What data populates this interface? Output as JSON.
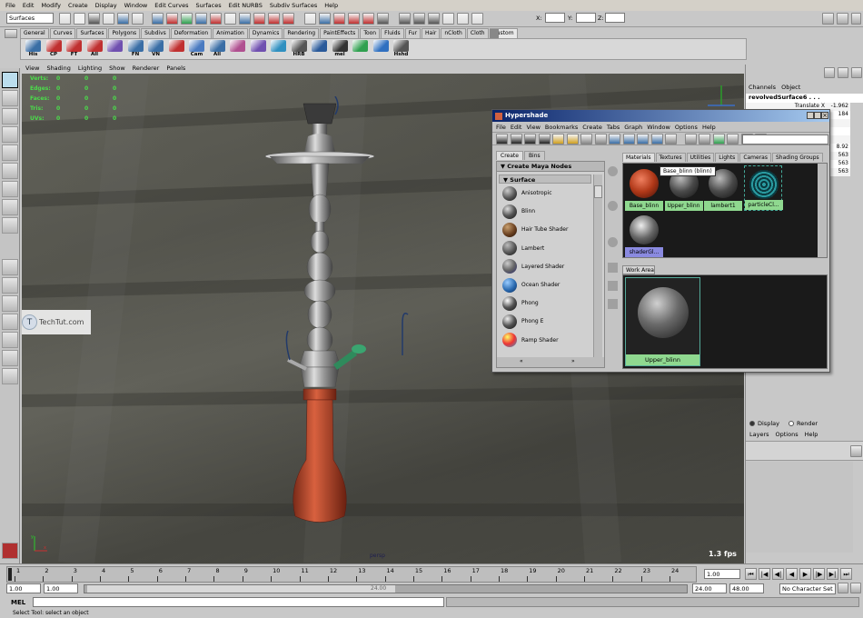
{
  "menubar": [
    "File",
    "Edit",
    "Modify",
    "Create",
    "Display",
    "Window",
    "Edit Curves",
    "Surfaces",
    "Edit NURBS",
    "Subdiv Surfaces",
    "Help"
  ],
  "status_line": {
    "menu_set": "Surfaces",
    "x_label": "X:",
    "y_label": "Y:",
    "z_label": "Z:"
  },
  "shelf_tabs": [
    "General",
    "Curves",
    "Surfaces",
    "Polygons",
    "Subdivs",
    "Deformation",
    "Animation",
    "Dynamics",
    "Rendering",
    "PaintEffects",
    "Toon",
    "Fluids",
    "Fur",
    "Hair",
    "nCloth",
    "Cloth",
    "Custom"
  ],
  "shelf_tab_active": "Custom",
  "shelf_buttons": [
    {
      "label": "His",
      "color": "#3a6ea5"
    },
    {
      "label": "CP",
      "color": "#c03030"
    },
    {
      "label": "FT",
      "color": "#c03030"
    },
    {
      "label": "All",
      "color": "#c03030"
    },
    {
      "label": "",
      "color": "#7050b0"
    },
    {
      "label": "FN",
      "color": "#3a6ea5"
    },
    {
      "label": "VN",
      "color": "#3a6ea5"
    },
    {
      "label": "",
      "color": "#c03030"
    },
    {
      "label": "Cam",
      "color": "#4a7ac0"
    },
    {
      "label": "All",
      "color": "#3a6ea5"
    },
    {
      "label": "",
      "color": "#b05090"
    },
    {
      "label": "",
      "color": "#7050b0"
    },
    {
      "label": "",
      "color": "#3090c0"
    },
    {
      "label": "HRB",
      "color": "#555555"
    },
    {
      "label": "",
      "color": "#2a5a9a"
    },
    {
      "label": "mel",
      "color": "#333333"
    },
    {
      "label": "",
      "color": "#30a050"
    },
    {
      "label": "",
      "color": "#3070c0"
    },
    {
      "label": "Hshd",
      "color": "#555555"
    }
  ],
  "viewport": {
    "menu": [
      "View",
      "Shading",
      "Lighting",
      "Show",
      "Renderer",
      "Panels"
    ],
    "hud": [
      {
        "label": "Verts:",
        "v": [
          "0",
          "0",
          "0"
        ]
      },
      {
        "label": "Edges:",
        "v": [
          "0",
          "0",
          "0"
        ]
      },
      {
        "label": "Faces:",
        "v": [
          "0",
          "0",
          "0"
        ]
      },
      {
        "label": "Tris:",
        "v": [
          "0",
          "0",
          "0"
        ]
      },
      {
        "label": "UVs:",
        "v": [
          "0",
          "0",
          "0"
        ]
      }
    ],
    "camera_label": "persp",
    "fps": "1.3 fps",
    "watermark": "TechTut.com"
  },
  "channels": {
    "header_items": [
      "Channels",
      "Object"
    ],
    "object_name": "revolvedSurface6 . . .",
    "rows": [
      {
        "label": "Translate X",
        "value": "-1.962"
      },
      {
        "label": "",
        "value": "184"
      },
      {
        "label": "",
        "value": ""
      },
      {
        "label": "",
        "value": ""
      },
      {
        "label": "",
        "value": ""
      },
      {
        "label": "",
        "value": "8.92"
      },
      {
        "label": "",
        "value": "563"
      },
      {
        "label": "",
        "value": "563"
      },
      {
        "label": "",
        "value": "563"
      }
    ],
    "layer_tabs": [
      "Display",
      "Render"
    ],
    "layer_menu": [
      "Layers",
      "Options",
      "Help"
    ]
  },
  "hypershade": {
    "title": "Hypershade",
    "menu": [
      "File",
      "Edit",
      "View",
      "Bookmarks",
      "Create",
      "Tabs",
      "Graph",
      "Window",
      "Options",
      "Help"
    ],
    "left_tabs": [
      "Create",
      "Bins"
    ],
    "create_header": "Create Maya Nodes",
    "surface_header": "Surface",
    "nodes": [
      {
        "label": "Anisotropic"
      },
      {
        "label": "Blinn"
      },
      {
        "label": "Hair Tube Shader"
      },
      {
        "label": "Lambert"
      },
      {
        "label": "Layered Shader"
      },
      {
        "label": "Ocean Shader"
      },
      {
        "label": "Phong"
      },
      {
        "label": "Phong E"
      },
      {
        "label": "Ramp Shader"
      }
    ],
    "top_tabs": [
      "Materials",
      "Textures",
      "Utilities",
      "Lights",
      "Cameras",
      "Shading Groups"
    ],
    "swatches": [
      {
        "label": "Base_blinn",
        "selected": false,
        "kind": "red"
      },
      {
        "label": "Upper_blinn",
        "selected": false,
        "kind": "gray"
      },
      {
        "label": "lambert1",
        "selected": false,
        "kind": "gray"
      },
      {
        "label": "particleCl...",
        "selected": false,
        "kind": "particle"
      },
      {
        "label": "shaderGl...",
        "selected": true,
        "kind": "glow"
      }
    ],
    "tooltip": "Base_blinn (blinn)",
    "work_area_tab": "Work Area",
    "work_area_node": "Upper_blinn"
  },
  "timeline": {
    "ticks": [
      "1",
      "2",
      "3",
      "4",
      "5",
      "6",
      "7",
      "8",
      "9",
      "10",
      "11",
      "12",
      "13",
      "14",
      "15",
      "16",
      "17",
      "18",
      "19",
      "20",
      "21",
      "22",
      "23",
      "24"
    ],
    "current_frame": "1.00"
  },
  "range": {
    "start": "1.00",
    "anim_start": "1.00",
    "slider_label": "24.00",
    "end": "24.00",
    "anim_end": "48.00",
    "character_set": "No Character Set"
  },
  "command_line_label": "MEL",
  "help_line": "Select Tool: select an object"
}
